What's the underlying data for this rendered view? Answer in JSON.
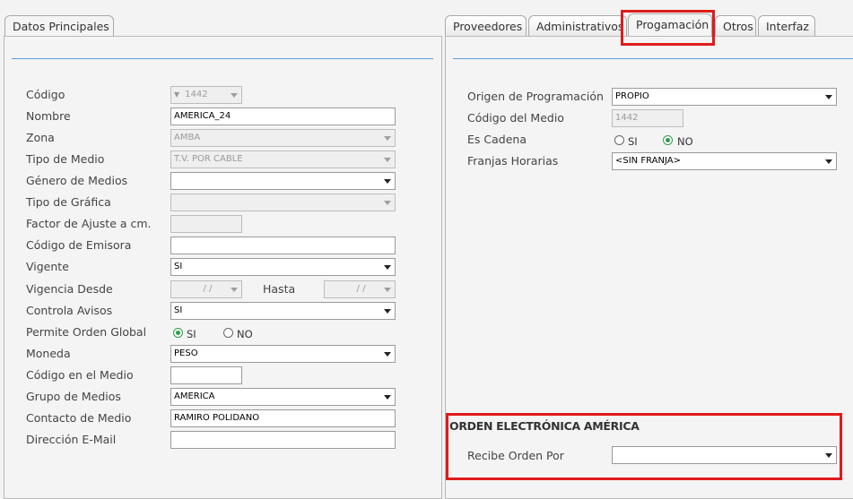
{
  "left_panel": {
    "tab": "Datos Principales",
    "fields": [
      {
        "label": "Código",
        "value": "1442",
        "type": "select",
        "disabled": true,
        "prefix_icon": "▼"
      },
      {
        "label": "Nombre",
        "value": "AMERICA_24",
        "type": "text"
      },
      {
        "label": "Zona",
        "value": "AMBA",
        "type": "select",
        "disabled": true
      },
      {
        "label": "Tipo de Medio",
        "value": "T.V. POR CABLE",
        "type": "select",
        "disabled": true
      },
      {
        "label": "Género de Medios",
        "value": "",
        "type": "select"
      },
      {
        "label": "Tipo de Gráfica",
        "value": "",
        "type": "select",
        "disabled": true
      },
      {
        "label": "Factor de Ajuste a cm.",
        "value": "",
        "type": "text",
        "disabled": true
      },
      {
        "label": "Código de Emisora",
        "value": "",
        "type": "text"
      },
      {
        "label": "Vigente",
        "value": "SI",
        "type": "select"
      },
      {
        "label": "Vigencia Desde",
        "value": " /  / ",
        "type": "date"
      },
      {
        "label": "Controla Avisos",
        "value": "SI",
        "type": "select"
      },
      {
        "label": "Permite Orden Global",
        "type": "radio"
      },
      {
        "label": "Moneda",
        "value": "PESO",
        "type": "select"
      },
      {
        "label": "Código en el Medio",
        "value": "",
        "type": "text"
      },
      {
        "label": "Grupo de Medios",
        "value": "AMERICA",
        "type": "select"
      },
      {
        "label": "Contacto de Medio",
        "value": "RAMIRO POLIDANO",
        "type": "text"
      },
      {
        "label": "Dirección E-Mail",
        "value": "",
        "type": "text"
      }
    ],
    "hasta_label": "Hasta",
    "hasta_value": " /  / ",
    "radio_si": "SI",
    "radio_no": "NO",
    "radio_selected": "SI"
  },
  "right_panel": {
    "tabs": [
      "Proveedores",
      "Administrativos",
      "Progamación",
      "Otros",
      "Interfaz"
    ],
    "active_tab": "Progamación",
    "fields": {
      "origen_label": "Origen de Programación",
      "origen_value": "PROPIO",
      "codigo_medio_label": "Código del Medio",
      "codigo_medio_value": "1442",
      "es_cadena_label": "Es Cadena",
      "es_cadena_si": "SI",
      "es_cadena_no": "NO",
      "es_cadena_selected": "NO",
      "franjas_label": "Franjas Horarias",
      "franjas_value": "<SIN FRANJA>"
    },
    "orden_section": {
      "title": "ORDEN ELECTRÓNICA AMÉRICA",
      "recibe_label": "Recibe Orden Por",
      "recibe_value": ""
    }
  },
  "colors": {
    "highlight": "#e01b1b",
    "separator": "#5b9bd5",
    "radio_selected": "#2e9e4a"
  }
}
